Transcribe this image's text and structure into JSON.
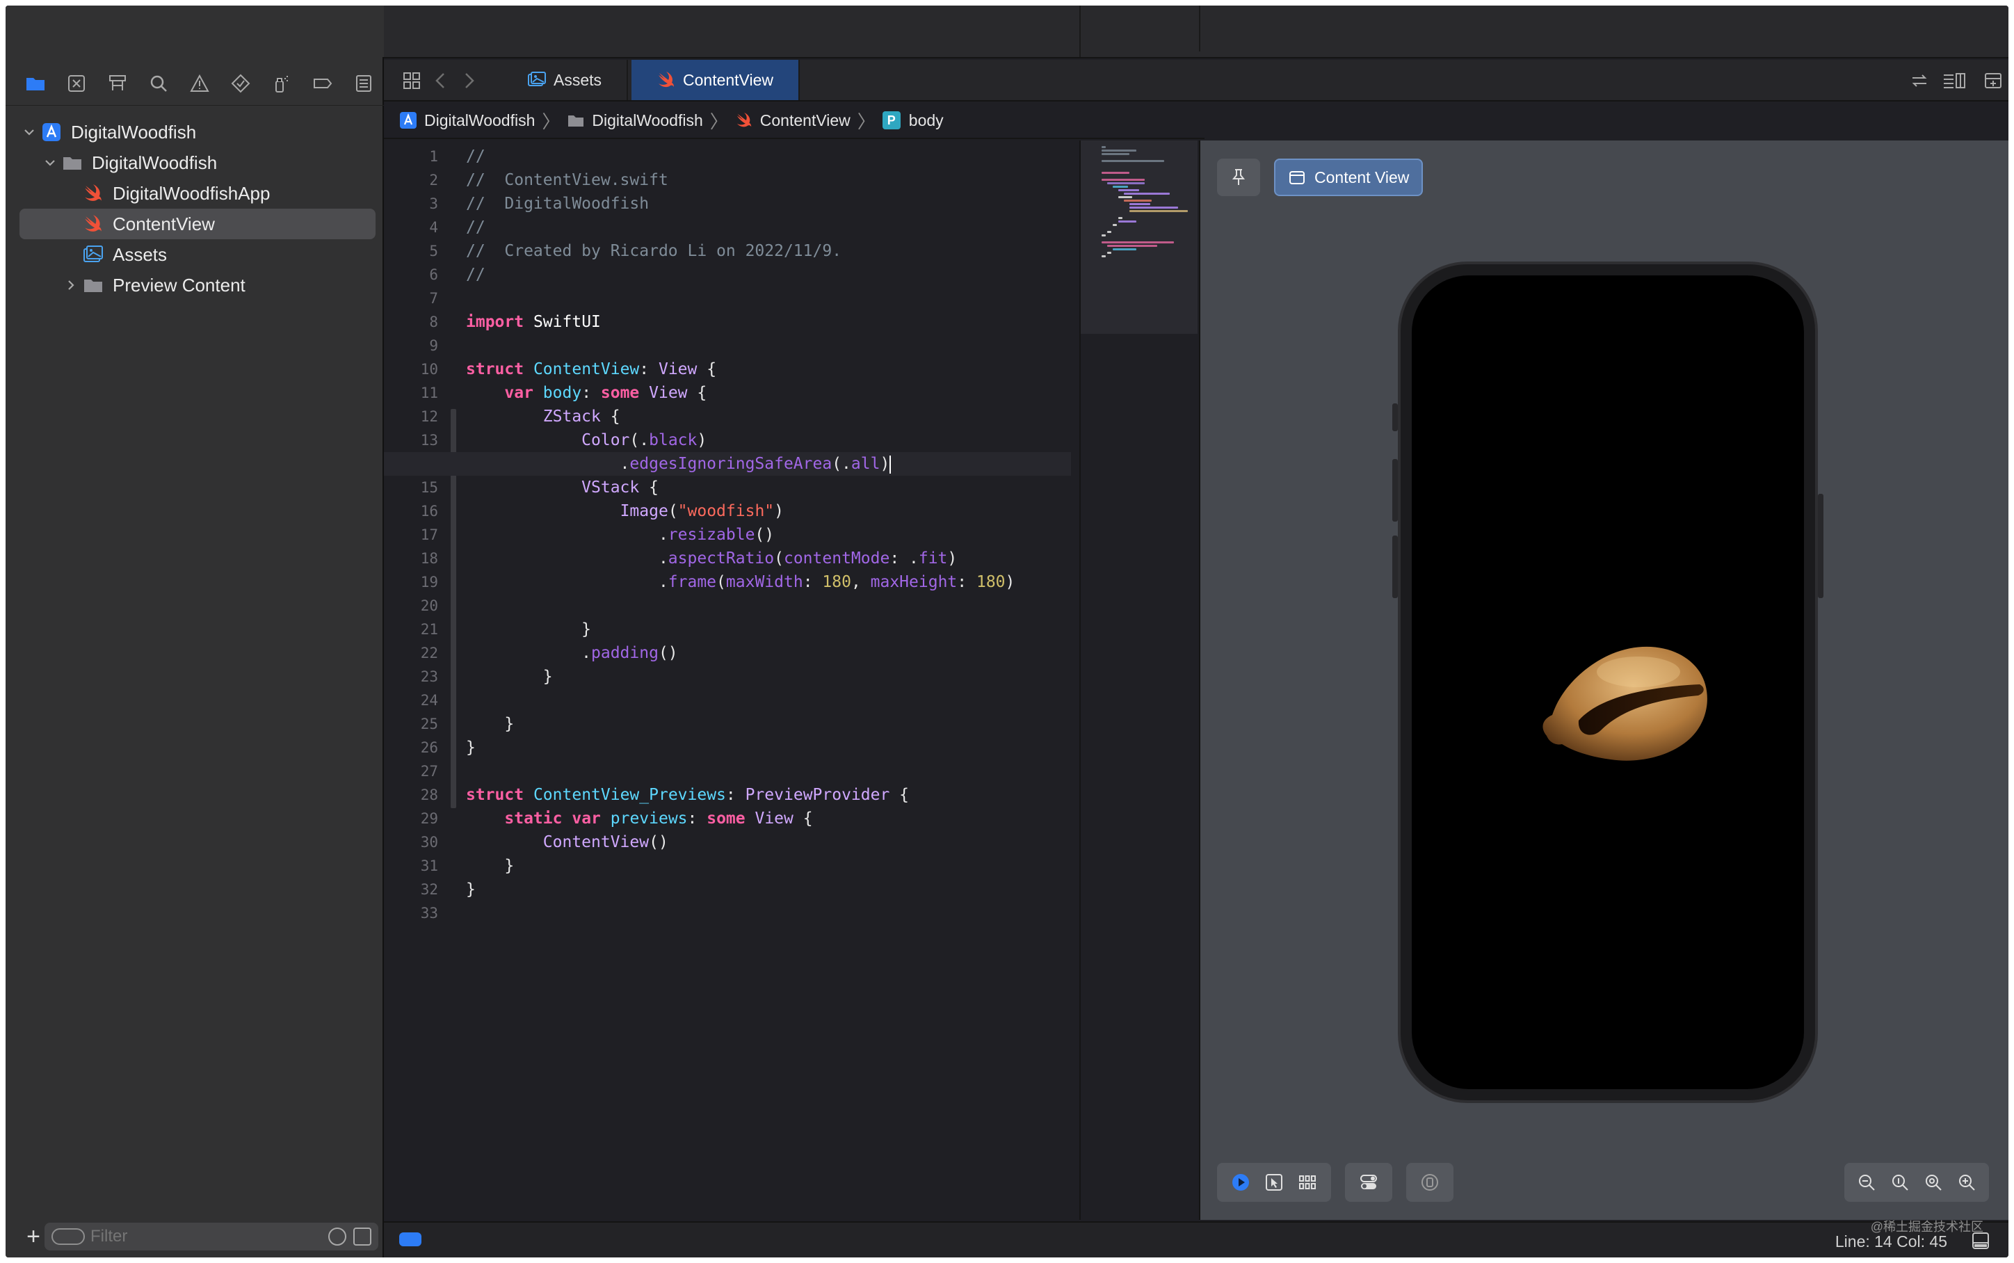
{
  "navigator": {
    "tree": [
      {
        "label": "DigitalWoodfish",
        "icon": "xcode-project-icon",
        "indent": 0,
        "chevron": "expanded",
        "selected": false
      },
      {
        "label": "DigitalWoodfish",
        "icon": "folder-icon",
        "indent": 1,
        "chevron": "expanded",
        "selected": false
      },
      {
        "label": "DigitalWoodfishApp",
        "icon": "swift-file-icon",
        "indent": 2,
        "chevron": "none",
        "selected": false
      },
      {
        "label": "ContentView",
        "icon": "swift-file-icon",
        "indent": 2,
        "chevron": "none",
        "selected": true
      },
      {
        "label": "Assets",
        "icon": "asset-catalog-icon",
        "indent": 2,
        "chevron": "none",
        "selected": false
      },
      {
        "label": "Preview Content",
        "icon": "folder-icon",
        "indent": 2,
        "chevron": "collapsed",
        "selected": false
      }
    ],
    "filter_placeholder": "Filter",
    "add_label": "+"
  },
  "tabs": [
    {
      "label": "Assets",
      "active": false
    },
    {
      "label": "ContentView",
      "active": true
    }
  ],
  "breadcrumb": [
    "DigitalWoodfish",
    "DigitalWoodfish",
    "ContentView",
    "body"
  ],
  "editor": {
    "current_line": 14,
    "lines": [
      "//",
      "//  ContentView.swift",
      "//  DigitalWoodfish",
      "//",
      "//  Created by Ricardo Li on 2022/11/9.",
      "//",
      "",
      "import SwiftUI",
      "",
      "struct ContentView: View {",
      "    var body: some View {",
      "        ZStack {",
      "            Color(.black)",
      "                .edgesIgnoringSafeArea(.all)",
      "            VStack {",
      "                Image(\"woodfish\")",
      "                    .resizable()",
      "                    .aspectRatio(contentMode: .fit)",
      "                    .frame(maxWidth: 180, maxHeight: 180)",
      "",
      "            }",
      "            .padding()",
      "        }",
      "",
      "    }",
      "}",
      "",
      "struct ContentView_Previews: PreviewProvider {",
      "    static var previews: some View {",
      "        ContentView()",
      "    }",
      "}",
      ""
    ]
  },
  "canvas": {
    "preview_label": "Content View"
  },
  "status": {
    "line_col": "Line: 14  Col: 45",
    "watermark": "@稀土掘金技术社区"
  },
  "colors": {
    "accent": "#2d7cf6",
    "tab_active": "#23457b",
    "swift_orange": "#f05138",
    "keyword": "#fc5fa3",
    "type": "#5dd8ff",
    "method": "#a167e6",
    "string": "#fc6a5d",
    "number": "#d0bf69",
    "comment": "#7f8c98"
  }
}
